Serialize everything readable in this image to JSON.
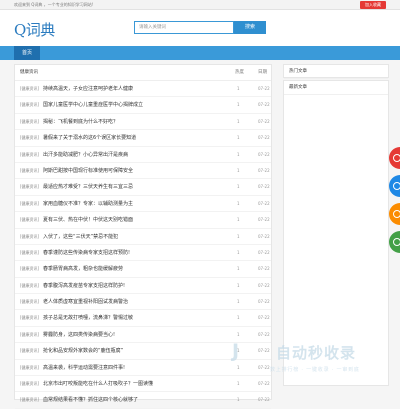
{
  "topbar": {
    "welcome": "欢迎来到 Q词典 ，一个专业的知识学习网站!",
    "fav_button": "加入收藏"
  },
  "header": {
    "logo": "Q词典"
  },
  "search": {
    "placeholder": "请输入关键词",
    "button_label": "搜索"
  },
  "nav": {
    "home": "首页"
  },
  "list": {
    "heading": "健康资讯",
    "col_views": "热度",
    "col_date": "日期",
    "rows": [
      {
        "category": "[健康资讯]",
        "title": "持续高温天，子女应注意呵护老年人健康",
        "views": "1",
        "date": "07-22"
      },
      {
        "category": "[健康资讯]",
        "title": "国家儿童医学中心儿童重症医学中心揭牌成立",
        "views": "1",
        "date": "07-22"
      },
      {
        "category": "[健康资讯]",
        "title": "揭秘：飞机餐到底为什么不好吃？",
        "views": "1",
        "date": "07-22"
      },
      {
        "category": "[健康资讯]",
        "title": "暑假来了关于溺水的这6个误区家长要知道",
        "views": "1",
        "date": "07-22"
      },
      {
        "category": "[健康资讯]",
        "title": "出汗多能助减肥？小心异常出汗是疾病",
        "views": "1",
        "date": "07-22"
      },
      {
        "category": "[健康资讯]",
        "title": "阿斯巴甜按中国现行标准使用可保障安全",
        "views": "1",
        "date": "07-22"
      },
      {
        "category": "[健康资讯]",
        "title": "最适应热才难受？三伏天养生有三宜三忌",
        "views": "1",
        "date": "07-22"
      },
      {
        "category": "[健康资讯]",
        "title": "家用血糖仪不准？专家：以辅助测量为主",
        "views": "1",
        "date": "07-22"
      },
      {
        "category": "[健康资讯]",
        "title": "夏有三伏、热在中伏！中伏这天别吃错面",
        "views": "1",
        "date": "07-22"
      },
      {
        "category": "[健康资讯]",
        "title": "入伏了，这些“三伏天”禁忌不能犯",
        "views": "1",
        "date": "07-22"
      },
      {
        "category": "[健康资讯]",
        "title": "春季谨防这些传染病专家支招这样预防!",
        "views": "1",
        "date": "07-22"
      },
      {
        "category": "[健康资讯]",
        "title": "春季肠胃病高发，粗杂也能缓解疲劳",
        "views": "1",
        "date": "07-22"
      },
      {
        "category": "[健康资讯]",
        "title": "春季腹泻高发疫苗专家支招这样防护!",
        "views": "1",
        "date": "07-22"
      },
      {
        "category": "[健康资讯]",
        "title": "老人体质虚寒宜重视补阳固试发病警治",
        "views": "1",
        "date": "07-22"
      },
      {
        "category": "[健康资讯]",
        "title": "孩子总是无故打喷嚏，流鼻涕？警惕过敏",
        "views": "1",
        "date": "07-22"
      },
      {
        "category": "[健康资讯]",
        "title": "雾霾防身，这四类传染病要当心!",
        "views": "1",
        "date": "07-22"
      },
      {
        "category": "[健康资讯]",
        "title": "抢化和品安规外家数会的“鹿伍瓶腐”",
        "views": "1",
        "date": "07-22"
      },
      {
        "category": "[健康资讯]",
        "title": "高温来袭，科学运动需要注意四件事!",
        "views": "1",
        "date": "07-22"
      },
      {
        "category": "[健康资讯]",
        "title": "北京市出叮咬叛能吃在什么人打吸吹子？一图读懂",
        "views": "1",
        "date": "07-22"
      },
      {
        "category": "[健康资讯]",
        "title": "血常规结果看不懂？抓住这四个核心就够了",
        "views": "1",
        "date": "07-22"
      }
    ]
  },
  "sidebar": {
    "hot_title": "热门文章",
    "latest_title": "最新文章"
  },
  "watermark": {
    "mark": "J",
    "main": "自动秒收录",
    "sub": "数上排行榜 · 一键收录 · 一审到底"
  },
  "colors": {
    "brand_blue": "#3a9ad9",
    "nav_active": "#1f6fae",
    "accent_red": "#e53935"
  }
}
